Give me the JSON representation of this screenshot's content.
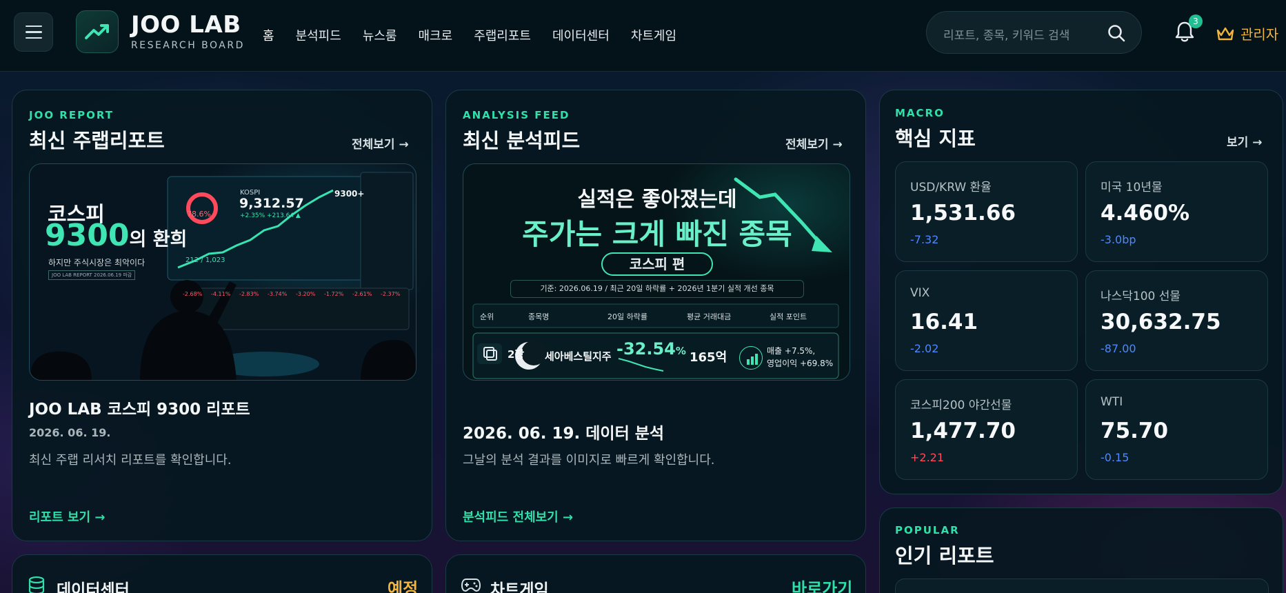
{
  "header": {
    "logo_title": "JOO LAB",
    "logo_subtitle": "RESEARCH BOARD",
    "nav": [
      "홈",
      "분석피드",
      "뉴스룸",
      "매크로",
      "주랩리포트",
      "데이터센터",
      "차트게임"
    ],
    "search_placeholder": "리포트, 종목, 키워드 검색",
    "notification_count": "3",
    "admin_label": "관리자"
  },
  "report_card": {
    "eyebrow": "JOO REPORT",
    "title": "최신 주랩리포트",
    "see_all": "전체보기 →",
    "thumb": {
      "headline_1": "코스피",
      "headline_2": "9300",
      "headline_3": "의 환희",
      "sub": "하지만 주식시장은 최악이다",
      "tag": "JOO LAB REPORT  2026.06.19 마감",
      "index_name": "KOSPI",
      "index_value": "9,312.57",
      "index_change": "+2.35%  +213.64 ▲",
      "peak_label": "9300+",
      "ratio": "78.6%",
      "count": "212 / 1,023",
      "tiles": [
        "-2.68%",
        "-4.11%",
        "-2.83%",
        "-3.74%",
        "-3.20%",
        "-1.72%",
        "-2.61%",
        "-2.37%"
      ]
    },
    "item_title": "JOO LAB 코스피 9300 리포트",
    "item_date": "2026. 06. 19.",
    "item_desc": "최신 주랩 리서치 리포트를 확인합니다.",
    "cta": "리포트 보기 →"
  },
  "feed_card": {
    "eyebrow": "ANALYSIS FEED",
    "title": "최신 분석피드",
    "see_all": "전체보기 →",
    "thumb": {
      "line1": "실적은 좋아졌는데",
      "line2": "주가는 크게 빠진 종목",
      "pill": "코스피 편",
      "basis": "기준: 2026.06.19 / 최근 20일 하락률 + 2026년 1분기 실적 개선 종목",
      "columns": [
        "순위",
        "종목명",
        "20일 하락률",
        "평균 거래대금",
        "실적 포인트"
      ],
      "row": {
        "badge": "2장",
        "name": "세아베스틸지주",
        "drop": "-32.54",
        "drop_unit": "%",
        "volume": "165억",
        "point1": "매출 +7.5%,",
        "point2": "영업이익 +69.8%"
      }
    },
    "item_title": "2026. 06. 19. 데이터 분석",
    "item_desc": "그날의 분석 결과를 이미지로 빠르게 확인합니다.",
    "cta": "분석피드 전체보기 →"
  },
  "macro_card": {
    "eyebrow": "MACRO",
    "title": "핵심 지표",
    "see_all": "보기 →",
    "metrics": [
      {
        "label": "USD/KRW 환율",
        "value": "1,531.66",
        "change": "-7.32"
      },
      {
        "label": "미국 10년물",
        "value": "4.460%",
        "change": "-3.0bp"
      },
      {
        "label": "VIX",
        "value": "16.41",
        "change": "-2.02"
      },
      {
        "label": "나스닥100 선물",
        "value": "30,632.75",
        "change": "-87.00"
      },
      {
        "label": "코스피200 야간선물",
        "value": "1,477.70",
        "change": "+2.21"
      },
      {
        "label": "WTI",
        "value": "75.70",
        "change": "-0.15"
      }
    ]
  },
  "popular_card": {
    "eyebrow": "POPULAR",
    "title": "인기 리포트"
  },
  "data_center": {
    "title": "데이터센터",
    "tag": "예정"
  },
  "chart_game": {
    "title": "차트게임",
    "tag": "바로가기"
  },
  "colors": {
    "accent": "#2fe0a9",
    "gold": "#f2b43c",
    "negative": "#4f88ff",
    "positive": "#ff4a5c"
  }
}
